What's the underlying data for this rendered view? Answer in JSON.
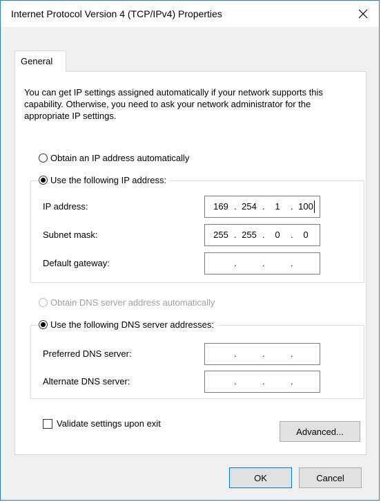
{
  "window": {
    "title": "Internet Protocol Version 4 (TCP/IPv4) Properties"
  },
  "tab": {
    "label": "General"
  },
  "intro_text": "You can get IP settings assigned automatically if your network supports this capability. Otherwise, you need to ask your network administrator for the appropriate IP settings.",
  "ip_section": {
    "auto_label": "Obtain an IP address automatically",
    "manual_label": "Use the following IP address:",
    "selected": "manual",
    "fields": [
      {
        "label": "IP address:",
        "octets": [
          "169",
          "254",
          "1",
          "100"
        ]
      },
      {
        "label": "Subnet mask:",
        "octets": [
          "255",
          "255",
          "0",
          "0"
        ]
      },
      {
        "label": "Default gateway:",
        "octets": [
          "",
          "",
          "",
          ""
        ]
      }
    ]
  },
  "dns_section": {
    "auto_label": "Obtain DNS server address automatically",
    "manual_label": "Use the following DNS server addresses:",
    "selected": "manual",
    "fields": [
      {
        "label": "Preferred DNS server:",
        "octets": [
          "",
          "",
          "",
          ""
        ]
      },
      {
        "label": "Alternate DNS server:",
        "octets": [
          "",
          "",
          "",
          ""
        ]
      }
    ]
  },
  "validate_label": "Validate settings upon exit",
  "validate_checked": false,
  "buttons": {
    "advanced": "Advanced...",
    "ok": "OK",
    "cancel": "Cancel"
  }
}
